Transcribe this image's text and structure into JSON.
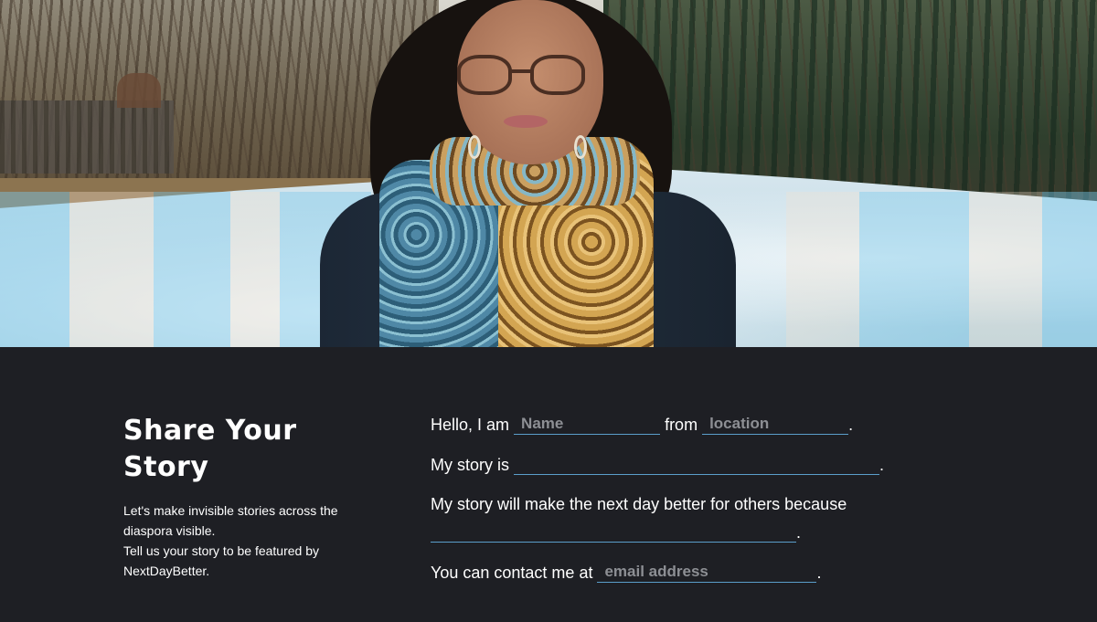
{
  "intro": {
    "title": "Share Your Story",
    "description_line1": "Let's make invisible stories across the diaspora visible.",
    "description_line2": "Tell us your story to be featured by NextDayBetter."
  },
  "form": {
    "hello_prefix": "Hello, I am",
    "name_placeholder": "Name",
    "from_label": "from",
    "location_placeholder": "location",
    "period": ".",
    "story_prefix": "My story is",
    "story_value": "",
    "because_prefix": "My story will make the next day better for others because",
    "because_value": "",
    "contact_prefix": "You can contact me at",
    "email_placeholder": "email address"
  },
  "colors": {
    "background": "#1e1f24",
    "underline": "#5b9ecb",
    "placeholder": "#8d8f94",
    "text": "#ffffff"
  }
}
